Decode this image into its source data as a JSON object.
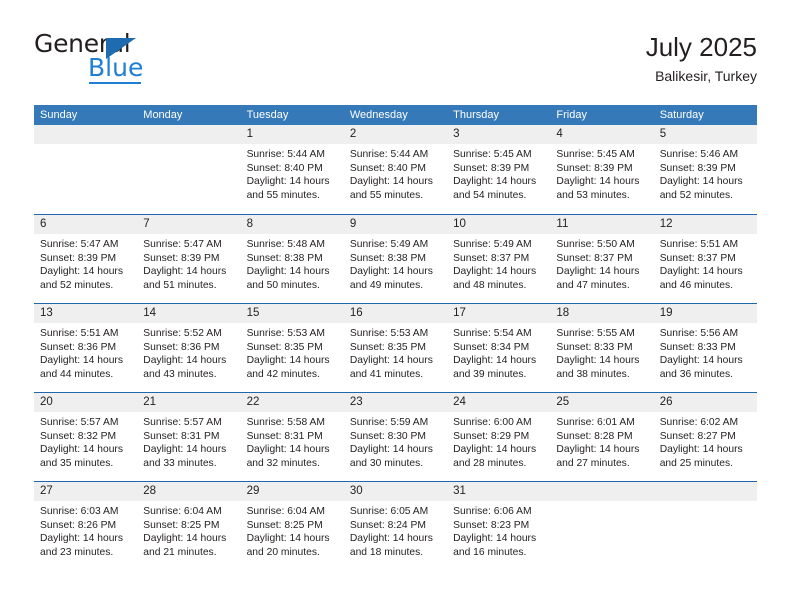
{
  "logo": {
    "general_text": "General",
    "blue_text": "Blue",
    "triangle_color": "#1e6bb0",
    "blue_color": "#1e7fd4"
  },
  "header": {
    "title": "July 2025",
    "subtitle": "Balikesir, Turkey"
  },
  "theme": {
    "header_bg": "#3579b8",
    "week_divider": "#2167ad",
    "daynum_band": "#efeff0",
    "text": "#231f20"
  },
  "calendar": {
    "weekday_headers": [
      "Sunday",
      "Monday",
      "Tuesday",
      "Wednesday",
      "Thursday",
      "Friday",
      "Saturday"
    ],
    "weeks": [
      [
        {
          "day": "",
          "lines": []
        },
        {
          "day": "",
          "lines": []
        },
        {
          "day": "1",
          "lines": [
            "Sunrise: 5:44 AM",
            "Sunset: 8:40 PM",
            "Daylight: 14 hours",
            "and 55 minutes."
          ]
        },
        {
          "day": "2",
          "lines": [
            "Sunrise: 5:44 AM",
            "Sunset: 8:40 PM",
            "Daylight: 14 hours",
            "and 55 minutes."
          ]
        },
        {
          "day": "3",
          "lines": [
            "Sunrise: 5:45 AM",
            "Sunset: 8:39 PM",
            "Daylight: 14 hours",
            "and 54 minutes."
          ]
        },
        {
          "day": "4",
          "lines": [
            "Sunrise: 5:45 AM",
            "Sunset: 8:39 PM",
            "Daylight: 14 hours",
            "and 53 minutes."
          ]
        },
        {
          "day": "5",
          "lines": [
            "Sunrise: 5:46 AM",
            "Sunset: 8:39 PM",
            "Daylight: 14 hours",
            "and 52 minutes."
          ]
        }
      ],
      [
        {
          "day": "6",
          "lines": [
            "Sunrise: 5:47 AM",
            "Sunset: 8:39 PM",
            "Daylight: 14 hours",
            "and 52 minutes."
          ]
        },
        {
          "day": "7",
          "lines": [
            "Sunrise: 5:47 AM",
            "Sunset: 8:39 PM",
            "Daylight: 14 hours",
            "and 51 minutes."
          ]
        },
        {
          "day": "8",
          "lines": [
            "Sunrise: 5:48 AM",
            "Sunset: 8:38 PM",
            "Daylight: 14 hours",
            "and 50 minutes."
          ]
        },
        {
          "day": "9",
          "lines": [
            "Sunrise: 5:49 AM",
            "Sunset: 8:38 PM",
            "Daylight: 14 hours",
            "and 49 minutes."
          ]
        },
        {
          "day": "10",
          "lines": [
            "Sunrise: 5:49 AM",
            "Sunset: 8:37 PM",
            "Daylight: 14 hours",
            "and 48 minutes."
          ]
        },
        {
          "day": "11",
          "lines": [
            "Sunrise: 5:50 AM",
            "Sunset: 8:37 PM",
            "Daylight: 14 hours",
            "and 47 minutes."
          ]
        },
        {
          "day": "12",
          "lines": [
            "Sunrise: 5:51 AM",
            "Sunset: 8:37 PM",
            "Daylight: 14 hours",
            "and 46 minutes."
          ]
        }
      ],
      [
        {
          "day": "13",
          "lines": [
            "Sunrise: 5:51 AM",
            "Sunset: 8:36 PM",
            "Daylight: 14 hours",
            "and 44 minutes."
          ]
        },
        {
          "day": "14",
          "lines": [
            "Sunrise: 5:52 AM",
            "Sunset: 8:36 PM",
            "Daylight: 14 hours",
            "and 43 minutes."
          ]
        },
        {
          "day": "15",
          "lines": [
            "Sunrise: 5:53 AM",
            "Sunset: 8:35 PM",
            "Daylight: 14 hours",
            "and 42 minutes."
          ]
        },
        {
          "day": "16",
          "lines": [
            "Sunrise: 5:53 AM",
            "Sunset: 8:35 PM",
            "Daylight: 14 hours",
            "and 41 minutes."
          ]
        },
        {
          "day": "17",
          "lines": [
            "Sunrise: 5:54 AM",
            "Sunset: 8:34 PM",
            "Daylight: 14 hours",
            "and 39 minutes."
          ]
        },
        {
          "day": "18",
          "lines": [
            "Sunrise: 5:55 AM",
            "Sunset: 8:33 PM",
            "Daylight: 14 hours",
            "and 38 minutes."
          ]
        },
        {
          "day": "19",
          "lines": [
            "Sunrise: 5:56 AM",
            "Sunset: 8:33 PM",
            "Daylight: 14 hours",
            "and 36 minutes."
          ]
        }
      ],
      [
        {
          "day": "20",
          "lines": [
            "Sunrise: 5:57 AM",
            "Sunset: 8:32 PM",
            "Daylight: 14 hours",
            "and 35 minutes."
          ]
        },
        {
          "day": "21",
          "lines": [
            "Sunrise: 5:57 AM",
            "Sunset: 8:31 PM",
            "Daylight: 14 hours",
            "and 33 minutes."
          ]
        },
        {
          "day": "22",
          "lines": [
            "Sunrise: 5:58 AM",
            "Sunset: 8:31 PM",
            "Daylight: 14 hours",
            "and 32 minutes."
          ]
        },
        {
          "day": "23",
          "lines": [
            "Sunrise: 5:59 AM",
            "Sunset: 8:30 PM",
            "Daylight: 14 hours",
            "and 30 minutes."
          ]
        },
        {
          "day": "24",
          "lines": [
            "Sunrise: 6:00 AM",
            "Sunset: 8:29 PM",
            "Daylight: 14 hours",
            "and 28 minutes."
          ]
        },
        {
          "day": "25",
          "lines": [
            "Sunrise: 6:01 AM",
            "Sunset: 8:28 PM",
            "Daylight: 14 hours",
            "and 27 minutes."
          ]
        },
        {
          "day": "26",
          "lines": [
            "Sunrise: 6:02 AM",
            "Sunset: 8:27 PM",
            "Daylight: 14 hours",
            "and 25 minutes."
          ]
        }
      ],
      [
        {
          "day": "27",
          "lines": [
            "Sunrise: 6:03 AM",
            "Sunset: 8:26 PM",
            "Daylight: 14 hours",
            "and 23 minutes."
          ]
        },
        {
          "day": "28",
          "lines": [
            "Sunrise: 6:04 AM",
            "Sunset: 8:25 PM",
            "Daylight: 14 hours",
            "and 21 minutes."
          ]
        },
        {
          "day": "29",
          "lines": [
            "Sunrise: 6:04 AM",
            "Sunset: 8:25 PM",
            "Daylight: 14 hours",
            "and 20 minutes."
          ]
        },
        {
          "day": "30",
          "lines": [
            "Sunrise: 6:05 AM",
            "Sunset: 8:24 PM",
            "Daylight: 14 hours",
            "and 18 minutes."
          ]
        },
        {
          "day": "31",
          "lines": [
            "Sunrise: 6:06 AM",
            "Sunset: 8:23 PM",
            "Daylight: 14 hours",
            "and 16 minutes."
          ]
        },
        {
          "day": "",
          "lines": []
        },
        {
          "day": "",
          "lines": []
        }
      ]
    ]
  }
}
